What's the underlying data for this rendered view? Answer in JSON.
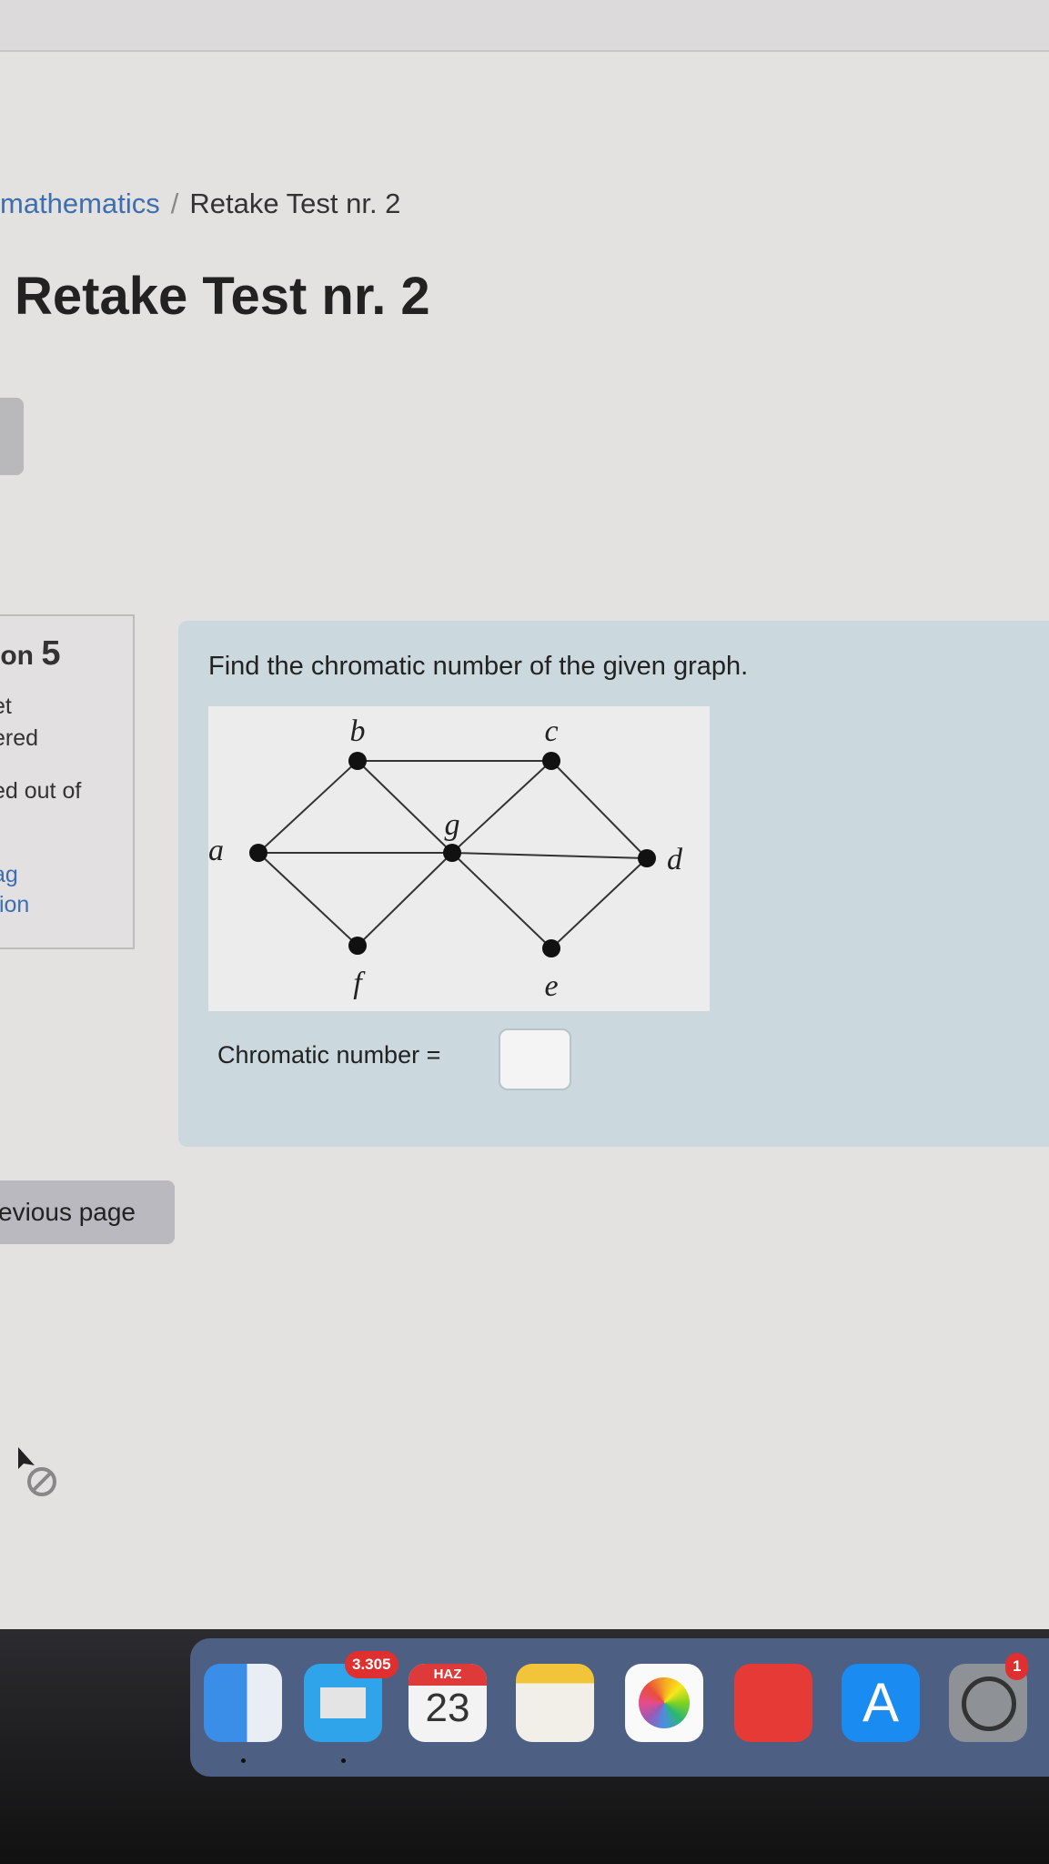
{
  "breadcrumb": {
    "course": "mathematics",
    "separator": "/",
    "current": "Retake Test nr. 2"
  },
  "page_title": "Retake Test nr. 2",
  "question_info": {
    "number_label": "ion",
    "number": "5",
    "status_line1": "et",
    "status_line2": "ered",
    "marks": "ed out of",
    "flag_line1": "ag",
    "flag_line2": "tion"
  },
  "question": {
    "text": "Find the chromatic number of the given graph.",
    "graph": {
      "vertices": [
        "a",
        "b",
        "c",
        "d",
        "e",
        "f",
        "g"
      ],
      "edges": [
        [
          "a",
          "b"
        ],
        [
          "a",
          "f"
        ],
        [
          "a",
          "g"
        ],
        [
          "g",
          "d"
        ],
        [
          "b",
          "c"
        ],
        [
          "b",
          "g"
        ],
        [
          "c",
          "g"
        ],
        [
          "c",
          "d"
        ],
        [
          "f",
          "g"
        ],
        [
          "g",
          "e"
        ],
        [
          "e",
          "d"
        ]
      ]
    },
    "answer_label": "Chromatic number =",
    "answer_value": ""
  },
  "nav": {
    "previous_label": "evious page"
  },
  "dock": {
    "apps": [
      {
        "name": "finder",
        "icon": "finder-icon"
      },
      {
        "name": "mail",
        "icon": "mail-icon",
        "badge": "3.305"
      },
      {
        "name": "calendar",
        "icon": "calendar-icon",
        "month": "HAZ",
        "day": "23"
      },
      {
        "name": "notes",
        "icon": "notes-icon"
      },
      {
        "name": "photos",
        "icon": "photos-icon"
      },
      {
        "name": "photo-booth",
        "icon": "photo-booth-icon"
      },
      {
        "name": "app-store",
        "icon": "app-store-icon"
      },
      {
        "name": "system-preferences",
        "icon": "gear-icon",
        "badge": "1"
      }
    ]
  }
}
